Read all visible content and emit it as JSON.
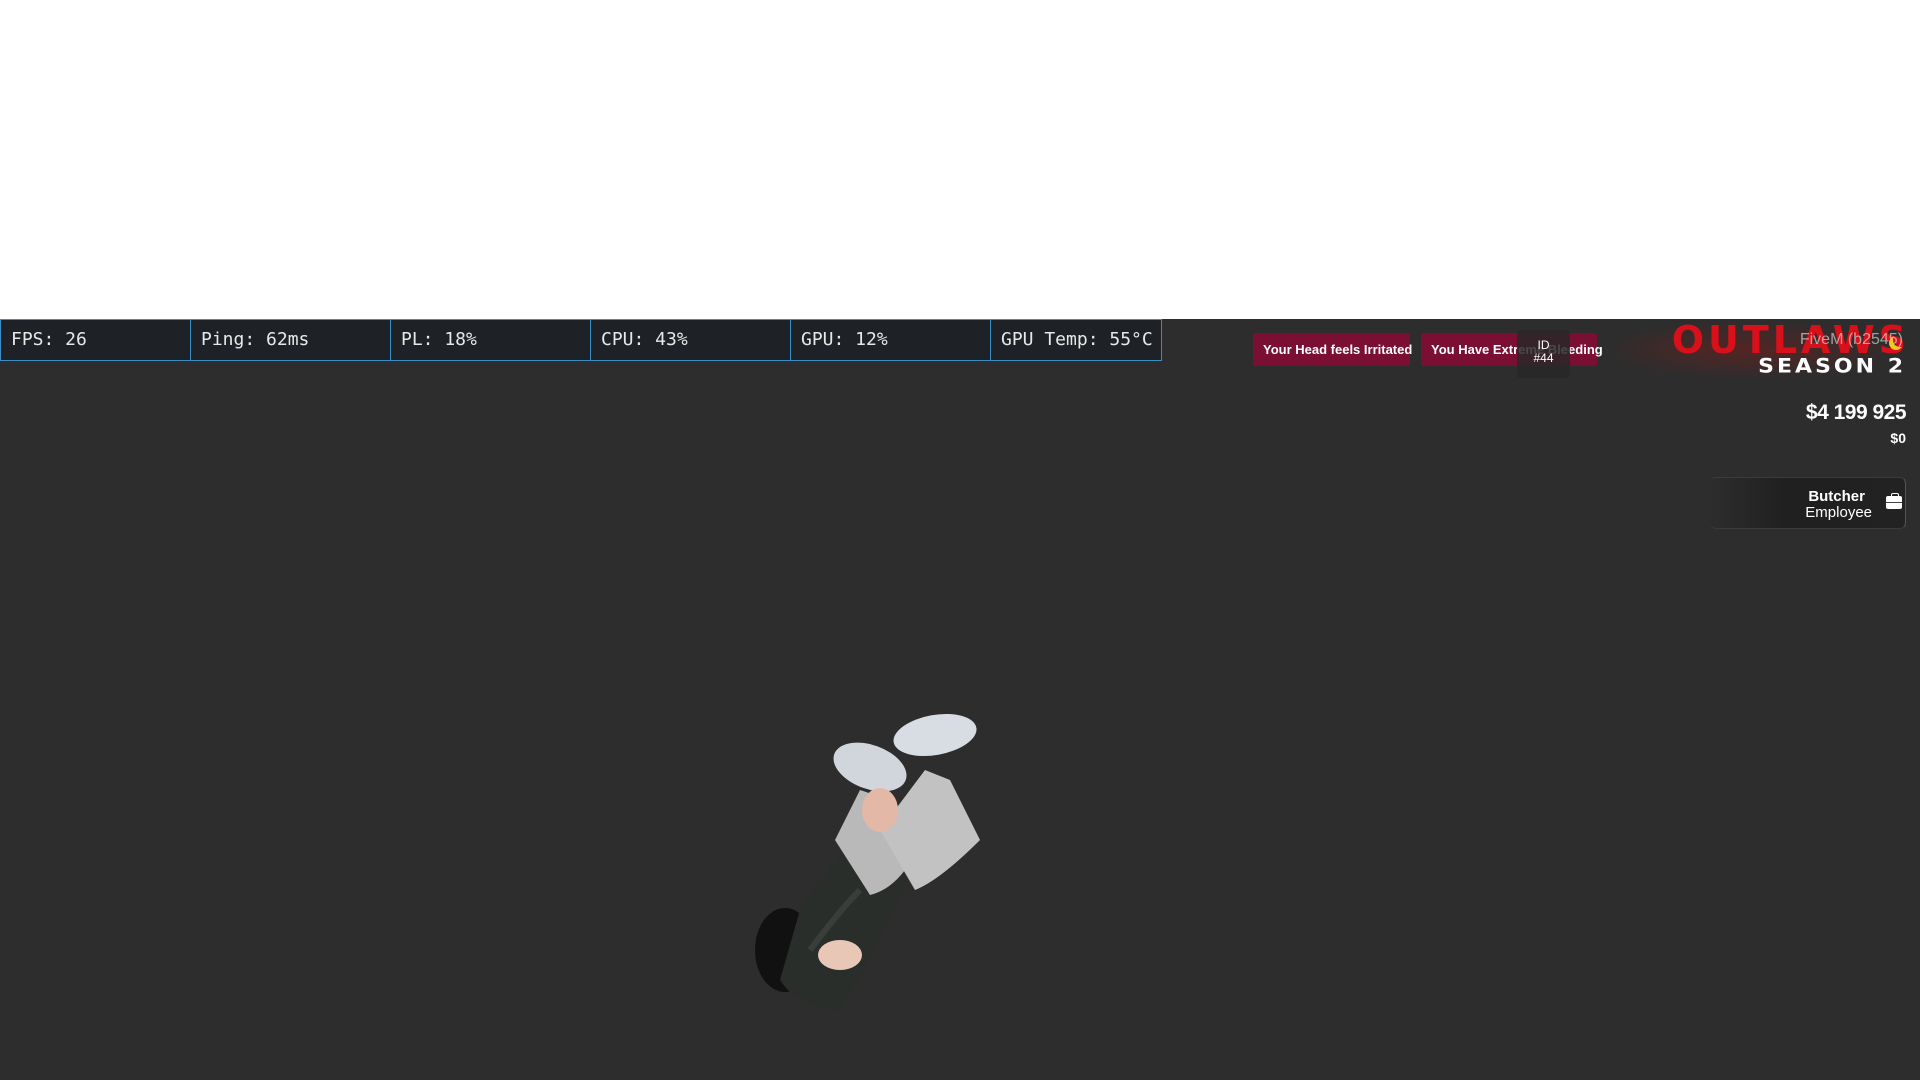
{
  "performance": {
    "fps": "FPS: 26",
    "ping": "Ping: 62ms",
    "packet_loss": "PL: 18%",
    "cpu": "CPU: 43%",
    "gpu": "GPU: 12%",
    "gpu_temp": "GPU Temp: 55°C"
  },
  "notifications": [
    {
      "text": "Your Head feels Irritated"
    },
    {
      "text": "You Have Extreme Bleeding"
    }
  ],
  "player_id": {
    "label": "ID",
    "value": "#44"
  },
  "server": {
    "logo_top": "OUTLAWS",
    "logo_bottom": "SEASON 2",
    "build": "FiveM (b2545)"
  },
  "money": {
    "cash": "$4 199 925",
    "bank": "$0"
  },
  "job": {
    "title": "Butcher",
    "grade": "Employee",
    "icon": "briefcase-icon"
  },
  "colors": {
    "notification_bg": "#7a0f33",
    "logo_red": "#d8101a",
    "perf_border": "#3b8ec6",
    "background": "#2d2d2d"
  }
}
